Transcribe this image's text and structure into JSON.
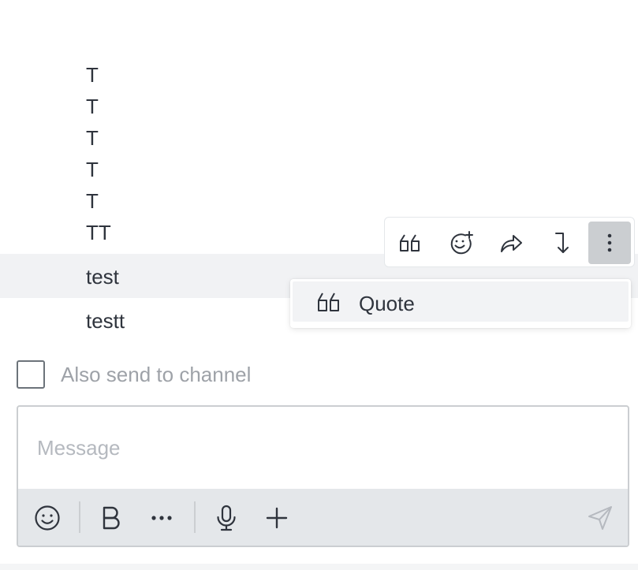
{
  "messages": [
    "T",
    "T",
    "T",
    "T",
    "T",
    "TT",
    "test",
    "testt"
  ],
  "action_toolbar": {
    "icons": [
      "quote-icon",
      "add-reaction-icon",
      "forward-icon",
      "reply-in-thread-icon",
      "kebab-menu-icon"
    ]
  },
  "context_menu": {
    "items": [
      {
        "label": "Quote",
        "icon": "quote-icon"
      }
    ]
  },
  "composer": {
    "also_send_label": "Also send to channel",
    "placeholder": "Message",
    "toolbar_icons": [
      "emoji-icon",
      "bold-icon",
      "more-formatting-icon",
      "microphone-icon",
      "plus-icon",
      "send-icon"
    ]
  },
  "colors": {
    "text": "#2f343d",
    "highlight_row": "#f1f2f4",
    "composer_toolbar_bg": "#e4e7ea",
    "placeholder": "#b5b9bf",
    "active_button": "#cbced1"
  }
}
